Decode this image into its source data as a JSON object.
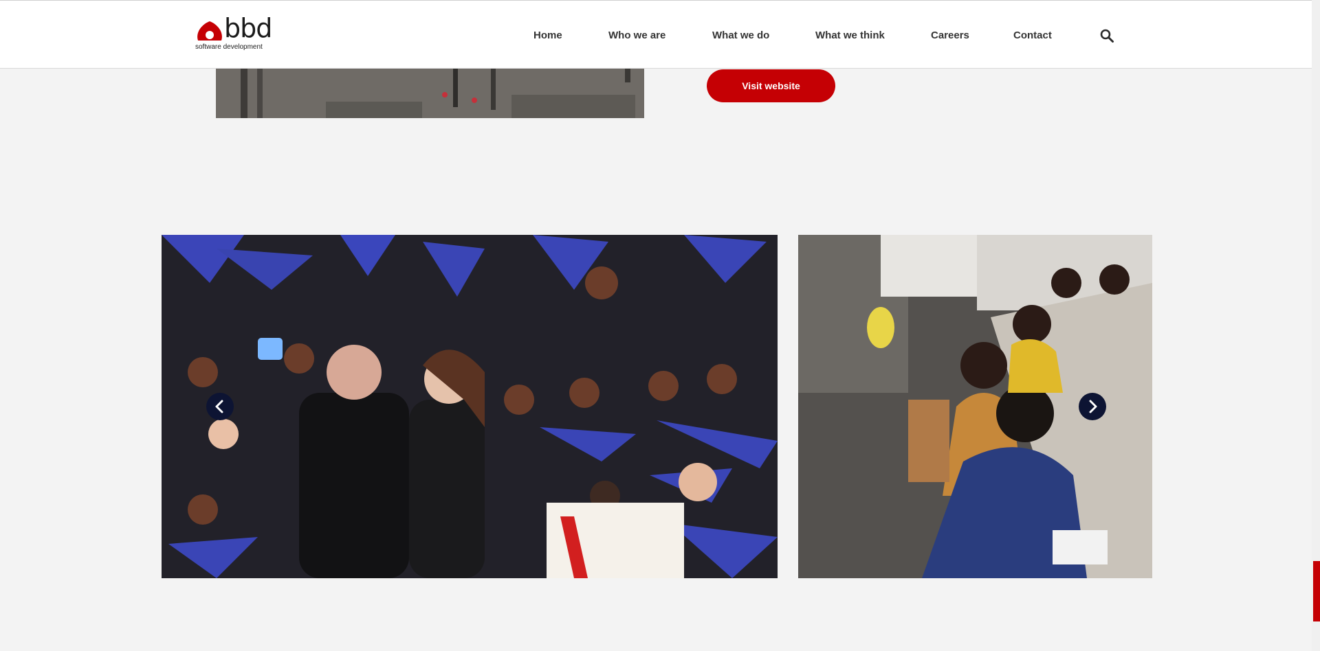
{
  "brand": {
    "name": "bbd",
    "tagline": "software development",
    "accent": "#c50004"
  },
  "nav": {
    "items": [
      "Home",
      "Who we are",
      "What we do",
      "What we think",
      "Careers",
      "Contact"
    ],
    "search_icon": "search-icon"
  },
  "cta": {
    "visit_label": "Visit website"
  },
  "slider": {
    "prev_icon": "chevron-left-icon",
    "next_icon": "chevron-right-icon",
    "arrow_color": "#0d1433",
    "slides": [
      "graduation-photo",
      "classroom-photo"
    ]
  },
  "colors": {
    "page_bg": "#f3f3f3",
    "header_bg": "#ffffff",
    "nav_text": "#333333"
  }
}
